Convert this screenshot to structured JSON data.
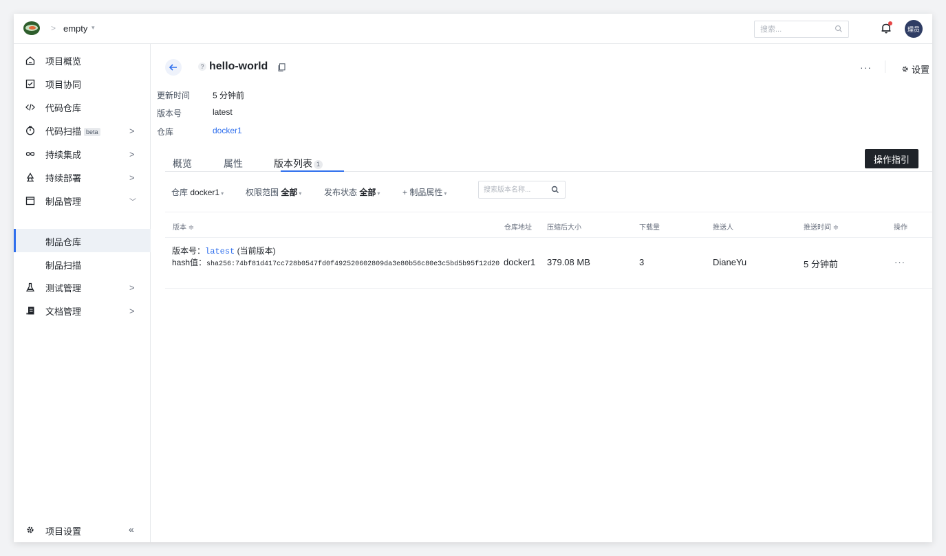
{
  "topbar": {
    "separator": ">",
    "project": "empty",
    "project_caret": "▾",
    "search_placeholder": "搜索...",
    "avatar_text": "理员"
  },
  "sidebar": {
    "items": [
      {
        "label": "项目概览",
        "icon": "home-icon",
        "arrow": ""
      },
      {
        "label": "项目协同",
        "icon": "checkbox-icon",
        "arrow": ""
      },
      {
        "label": "代码仓库",
        "icon": "code-icon",
        "arrow": ""
      },
      {
        "label": "代码扫描",
        "icon": "scan-icon",
        "arrow": ">",
        "badge": "beta"
      },
      {
        "label": "持续集成",
        "icon": "infinity-icon",
        "arrow": ">"
      },
      {
        "label": "持续部署",
        "icon": "deploy-icon",
        "arrow": ">"
      },
      {
        "label": "制品管理",
        "icon": "box-icon",
        "arrow": "﹀"
      },
      {
        "label": "测试管理",
        "icon": "flask-icon",
        "arrow": ">"
      },
      {
        "label": "文档管理",
        "icon": "doc-icon",
        "arrow": ">"
      }
    ],
    "sub_items": [
      {
        "label": "制品仓库",
        "active": true
      },
      {
        "label": "制品扫描",
        "active": false
      }
    ],
    "footer": {
      "label": "项目设置",
      "collapse": "«"
    }
  },
  "header": {
    "title": "hello-world",
    "question_mark": "?",
    "more": "···",
    "settings": "设置"
  },
  "meta": {
    "updated_label": "更新时间",
    "updated_value": "5 分钟前",
    "version_label": "版本号",
    "version_value": "latest",
    "repo_label": "仓库",
    "repo_value": "docker1"
  },
  "tabs": {
    "overview": "概览",
    "attributes": "属性",
    "versions": "版本列表",
    "versions_count": "1",
    "guide_button": "操作指引"
  },
  "filters": {
    "repo_prefix": "仓库",
    "repo_value": "docker1",
    "scope_prefix": "权限范围",
    "scope_value": "全部",
    "status_prefix": "发布状态",
    "status_value": "全部",
    "attr": "+ 制品属性",
    "caret": "▾",
    "search_placeholder": "搜索版本名称..."
  },
  "table": {
    "headers": {
      "version": "版本 ≑",
      "repo_addr": "仓库地址",
      "size": "压缩后大小",
      "downloads": "下载量",
      "pusher": "推送人",
      "push_time": "推送时间 ≑",
      "actions": "操作"
    },
    "rows": [
      {
        "version_label": "版本号：",
        "version": "latest",
        "version_note": "(当前版本)",
        "hash_label": "hash值：",
        "hash": "sha256:74bf81d417cc728b0547fd0f492520602809da3e80b56c80e3c5bd5b95f12d20",
        "repo": "docker1",
        "size": "379.08 MB",
        "downloads": "3",
        "pusher": "DianeYu",
        "push_time": "5 分钟前",
        "more": "···"
      }
    ]
  }
}
